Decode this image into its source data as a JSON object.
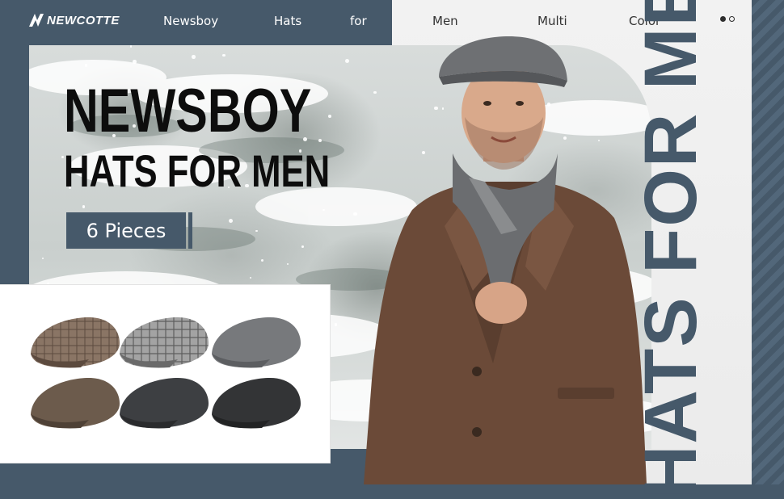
{
  "brand": {
    "logo_text": "NEWCOTTE"
  },
  "nav": {
    "words": [
      "Newsboy",
      "Hats",
      "for",
      "Men",
      "Multi",
      "Color"
    ]
  },
  "carousel": {
    "total_dots": 2,
    "active_index": 0
  },
  "hero": {
    "headline_line1": "NEWSBOY",
    "headline_line2": "HATS FOR MEN",
    "badge_text": "6 Pieces"
  },
  "side_banner": {
    "text": "HATS FOR MEN"
  },
  "swatches": [
    {
      "name": "brown-plaid-cap",
      "color": "#8a7565"
    },
    {
      "name": "grey-plaid-cap",
      "color": "#9a9a9a"
    },
    {
      "name": "light-grey-cap",
      "color": "#777a7d"
    },
    {
      "name": "brown-cap",
      "color": "#6c5b4c"
    },
    {
      "name": "charcoal-cap",
      "color": "#3d3f42"
    },
    {
      "name": "dark-grey-cap",
      "color": "#333436"
    }
  ],
  "colors": {
    "slate": "#46596a",
    "light_bg": "#f2f2f2",
    "headline": "#0d0d0d"
  }
}
